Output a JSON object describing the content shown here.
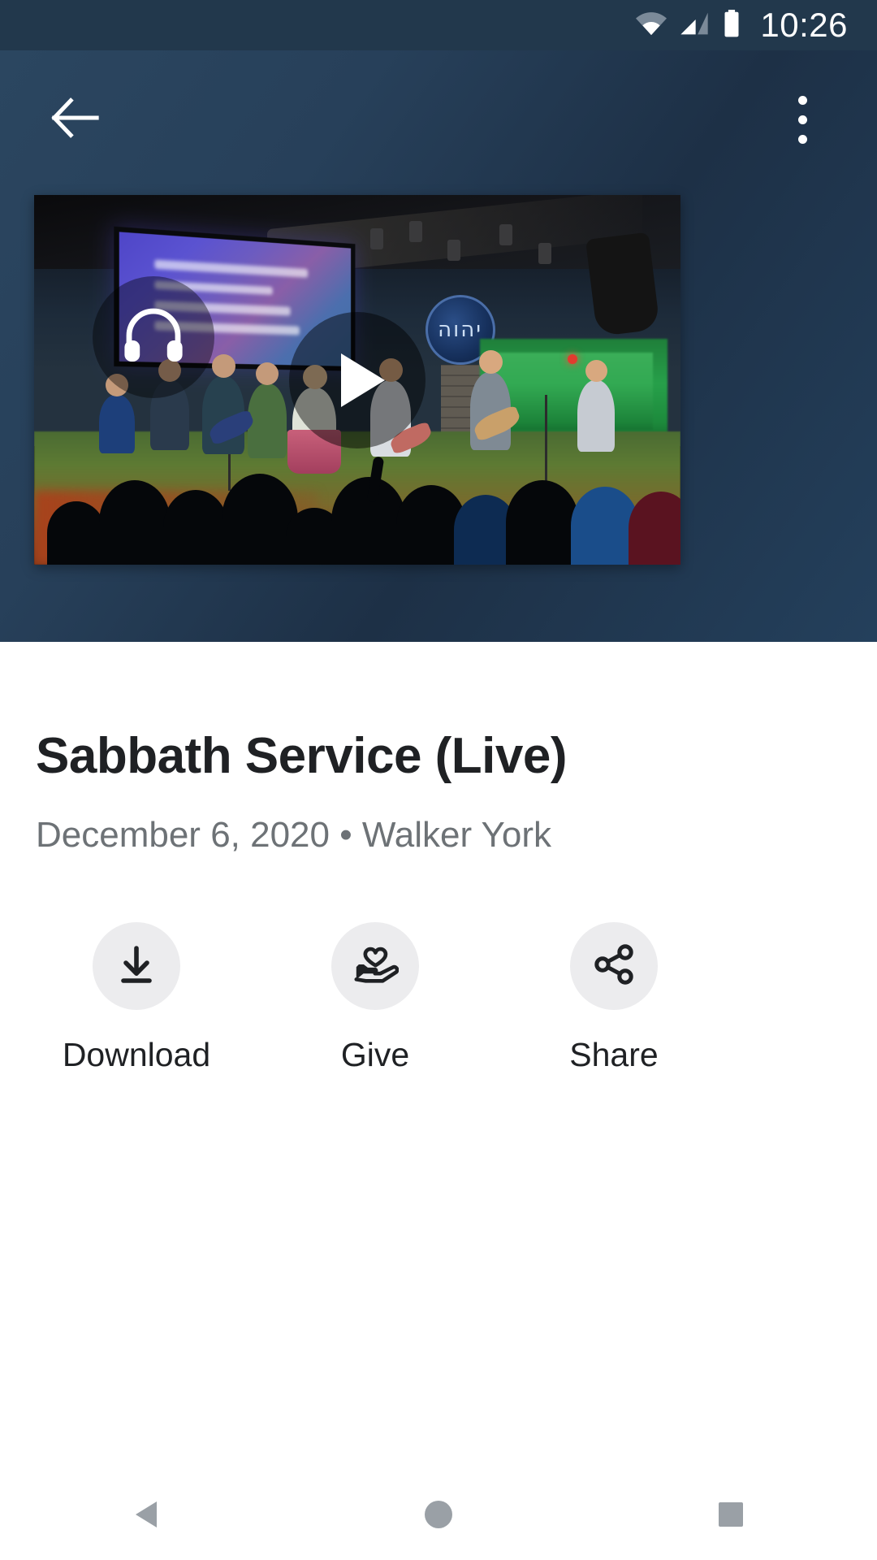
{
  "status_bar": {
    "time": "10:26",
    "icons": [
      "wifi-icon",
      "cellular-signal-icon",
      "battery-icon"
    ]
  },
  "app_bar": {
    "back_icon": "back-arrow-icon",
    "overflow_icon": "overflow-menu-icon"
  },
  "media": {
    "play_icon": "play-icon",
    "audio_badge_icon": "headphones-icon",
    "screen_text_lines": [
      "",
      "",
      "",
      ""
    ],
    "emblem_text": "יהוה"
  },
  "content": {
    "title": "Sabbath Service (Live)",
    "subtitle": "December 6, 2020 • Walker York",
    "date": "December 6, 2020",
    "speaker": "Walker York"
  },
  "actions": [
    {
      "label": "Download",
      "icon": "download-icon"
    },
    {
      "label": "Give",
      "icon": "hand-heart-icon"
    },
    {
      "label": "Share",
      "icon": "share-icon"
    }
  ],
  "nav_bar": {
    "back": "nav-back-icon",
    "home": "nav-home-icon",
    "recents": "nav-recents-icon"
  },
  "colors": {
    "header_bg": "#24405c",
    "sheet_bg": "#ffffff",
    "title_text": "#1f2124",
    "subtitle_text": "#6d7276",
    "action_circle": "#ececee",
    "nav_icon": "#9aa0a6"
  }
}
